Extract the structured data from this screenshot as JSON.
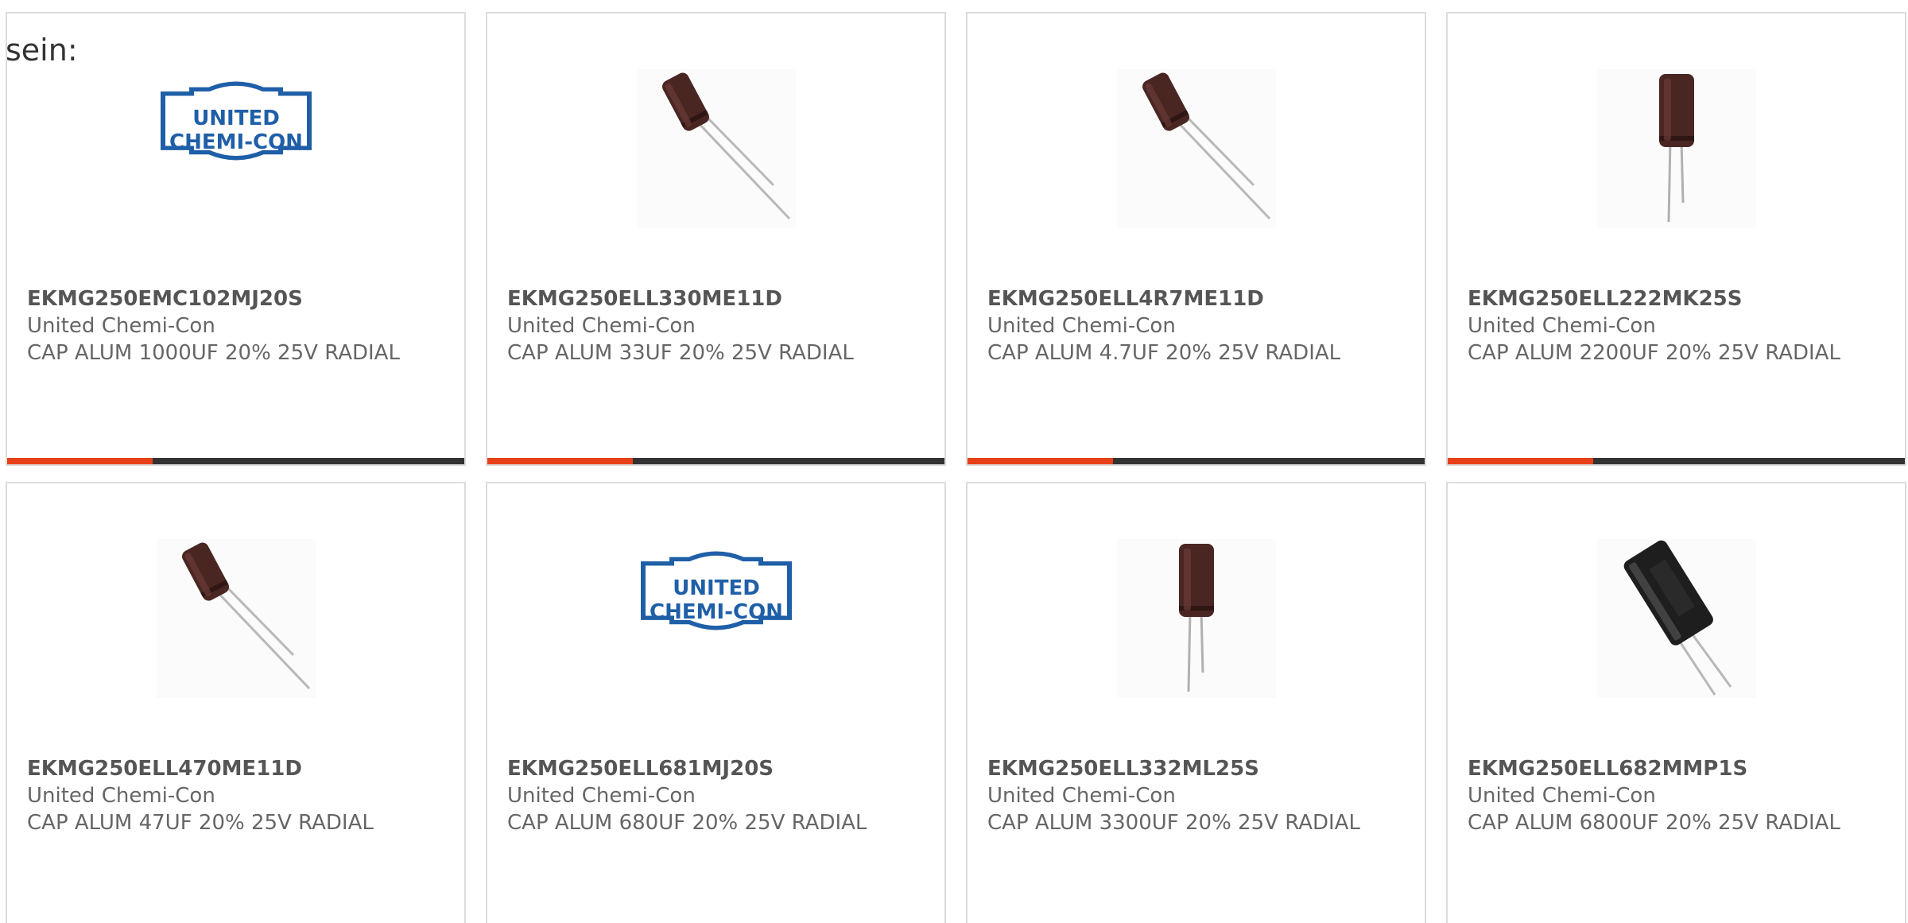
{
  "intro_text": "sein:",
  "colors": {
    "accent": "#e8411a",
    "bar": "#333333",
    "border": "#dcdcdc",
    "logo_blue": "#1f5fa8",
    "capacitor_brown": "#4a2623"
  },
  "cards": [
    {
      "part_number": "EKMG250EMC102MJ20S",
      "manufacturer": "United Chemi-Con",
      "description": "CAP ALUM 1000UF 20% 25V RADIAL",
      "image": "united-chemi-con-logo",
      "logo_line1": "UNITED",
      "logo_line2": "CHEMI-CON"
    },
    {
      "part_number": "EKMG250ELL330ME11D",
      "manufacturer": "United Chemi-Con",
      "description": "CAP ALUM 33UF 20% 25V RADIAL",
      "image": "capacitor-small-tilted"
    },
    {
      "part_number": "EKMG250ELL4R7ME11D",
      "manufacturer": "United Chemi-Con",
      "description": "CAP ALUM 4.7UF 20% 25V RADIAL",
      "image": "capacitor-small-tilted"
    },
    {
      "part_number": "EKMG250ELL222MK25S",
      "manufacturer": "United Chemi-Con",
      "description": "CAP ALUM 2200UF 20% 25V RADIAL",
      "image": "capacitor-upright"
    },
    {
      "part_number": "EKMG250ELL470ME11D",
      "manufacturer": "United Chemi-Con",
      "description": "CAP ALUM 47UF 20% 25V RADIAL",
      "image": "capacitor-small-tilted"
    },
    {
      "part_number": "EKMG250ELL681MJ20S",
      "manufacturer": "United Chemi-Con",
      "description": "CAP ALUM 680UF 20% 25V RADIAL",
      "image": "united-chemi-con-logo",
      "logo_line1": "UNITED",
      "logo_line2": "CHEMI-CON"
    },
    {
      "part_number": "EKMG250ELL332ML25S",
      "manufacturer": "United Chemi-Con",
      "description": "CAP ALUM 3300UF 20% 25V RADIAL",
      "image": "capacitor-upright"
    },
    {
      "part_number": "EKMG250ELL682MMP1S",
      "manufacturer": "United Chemi-Con",
      "description": "CAP ALUM 6800UF 20% 25V RADIAL",
      "image": "capacitor-large-black-tilted"
    }
  ]
}
